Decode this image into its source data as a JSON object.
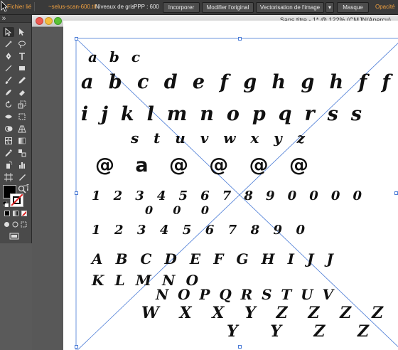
{
  "control_bar": {
    "fichier_lie": "Fichier lié",
    "filename": "~selus-scan-600.tif",
    "mode": "Niveaux de gris",
    "ppp": "PPP : 600",
    "incorporer": "Incorporer",
    "modifier": "Modifier l'original",
    "vectorisation": "Vectorisation de l'image",
    "vectorisation_arrow": "▾",
    "masque": "Masque",
    "opacite": "Opacité"
  },
  "tools_panel": {
    "grip_label": "››",
    "close_label": "x"
  },
  "document": {
    "title": "Sans titre - 1* @ 122% (CMJN/Aperçu)"
  },
  "handwriting": [
    "a b c",
    "a b c d e f g h g h f f",
    "i j k l m n o p q r s s",
    "s t u v w x y z",
    "@ a @ @ @ @",
    "1 2 3 4 5 6 7 8 9 0 0 0 0",
    "0 0 0",
    "1 2 3 4 5 6 7 8 9 0",
    "A B C D E F G H I J J",
    "K L M N O",
    "N O P Q R S T U V",
    "W X X Y Z Z Z Z",
    "Y Y Z Z"
  ],
  "colors": {
    "ui_dark": "#3a3a3a",
    "panel": "#4a4a4a",
    "canvas_bg": "#585858",
    "accent_orange": "#f0a040",
    "selection_blue": "#4a7bd6",
    "close_red": "#ee5a52",
    "minimize_yellow": "#f5be3d",
    "zoom_green": "#5bc236"
  }
}
